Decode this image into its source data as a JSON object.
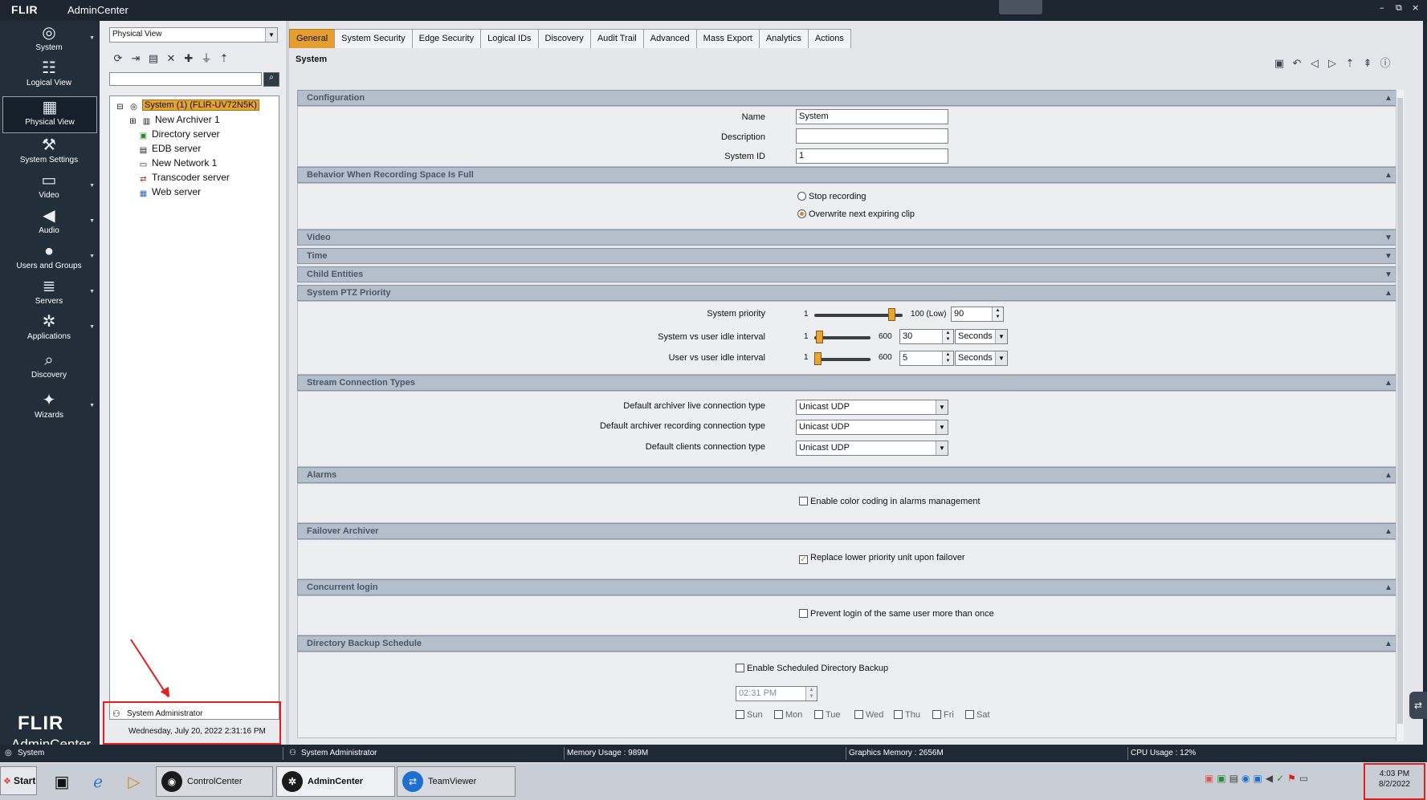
{
  "window": {
    "logo": "FLIR",
    "title": "AdminCenter",
    "controls": [
      "–",
      "⧉",
      "×"
    ]
  },
  "nav": {
    "items": [
      {
        "label": "System",
        "icon": "globe-icon"
      },
      {
        "label": "Logical View",
        "icon": "logical-view-icon"
      },
      {
        "label": "Physical View",
        "icon": "physical-view-icon"
      },
      {
        "label": "System Settings",
        "icon": "tools-icon"
      },
      {
        "label": "Video",
        "icon": "camera-icon"
      },
      {
        "label": "Audio",
        "icon": "speaker-icon"
      },
      {
        "label": "Users and Groups",
        "icon": "user-icon"
      },
      {
        "label": "Servers",
        "icon": "server-icon"
      },
      {
        "label": "Applications",
        "icon": "gear-icon"
      },
      {
        "label": "Discovery",
        "icon": "magnifier-icon"
      },
      {
        "label": "Wizards",
        "icon": "wand-icon"
      }
    ],
    "brand_logo": "FLIR",
    "brand_sub": "AdminCenter"
  },
  "tree": {
    "view_select": "Physical View",
    "root": "System (1) (FLIR-UV72N5K)",
    "children": [
      "New Archiver 1",
      "Directory server",
      "EDB server",
      "New Network 1",
      "Transcoder server",
      "Web server"
    ],
    "user": "System Administrator",
    "datetime": "Wednesday, July 20, 2022 2:31:16 PM"
  },
  "tabs": [
    "General",
    "System Security",
    "Edge Security",
    "Logical IDs",
    "Discovery",
    "Audit Trail",
    "Advanced",
    "Mass Export",
    "Analytics",
    "Actions"
  ],
  "page_title": "System",
  "sections": {
    "configuration": {
      "title": "Configuration",
      "name_label": "Name",
      "name_value": "System",
      "description_label": "Description",
      "description_value": "",
      "sysid_label": "System ID",
      "sysid_value": "1"
    },
    "behavior": {
      "title": "Behavior When Recording Space Is Full",
      "opt1": "Stop recording",
      "opt2": "Overwrite next expiring clip",
      "selected": "opt2"
    },
    "video": {
      "title": "Video"
    },
    "time": {
      "title": "Time"
    },
    "child": {
      "title": "Child Entities"
    },
    "ptz": {
      "title": "System PTZ Priority",
      "row1_label": "System priority",
      "row1_min": "1",
      "row1_max": "100 (Low)",
      "row1_value": "90",
      "row2_label": "System vs user idle interval",
      "row2_min": "1",
      "row2_max": "600",
      "row2_value": "30",
      "row2_unit": "Seconds",
      "row3_label": "User vs user idle interval",
      "row3_min": "1",
      "row3_max": "600",
      "row3_value": "5",
      "row3_unit": "Seconds"
    },
    "stream": {
      "title": "Stream Connection Types",
      "live_label": "Default archiver live connection type",
      "live_value": "Unicast UDP",
      "rec_label": "Default archiver recording connection type",
      "rec_value": "Unicast UDP",
      "clients_label": "Default clients connection type",
      "clients_value": "Unicast UDP"
    },
    "alarms": {
      "title": "Alarms",
      "check_label": "Enable color coding in alarms management",
      "checked": false
    },
    "failover": {
      "title": "Failover Archiver",
      "check_label": "Replace lower priority unit upon failover",
      "checked": true
    },
    "concurrent": {
      "title": "Concurrent login",
      "check_label": "Prevent login of the same user more than once",
      "checked": false
    },
    "backup": {
      "title": "Directory Backup Schedule",
      "check_label": "Enable Scheduled Directory Backup",
      "time_value": "02:31 PM",
      "days": [
        "Sun",
        "Mon",
        "Tue",
        "Wed",
        "Thu",
        "Fri",
        "Sat"
      ]
    }
  },
  "status": {
    "system": "System",
    "user": "System Administrator",
    "memory": "Memory Usage : 989M",
    "graphics": "Graphics Memory : 2656M",
    "cpu": "CPU Usage : 12%"
  },
  "taskbar": {
    "start": "Start",
    "tasks": [
      "ControlCenter",
      "AdminCenter",
      "TeamViewer"
    ],
    "clock_time": "4:03 PM",
    "clock_date": "8/2/2022"
  },
  "colors": {
    "accent": "#e59f31",
    "highlight_box": "#e0201c",
    "nav_bg": "#232e3b"
  }
}
